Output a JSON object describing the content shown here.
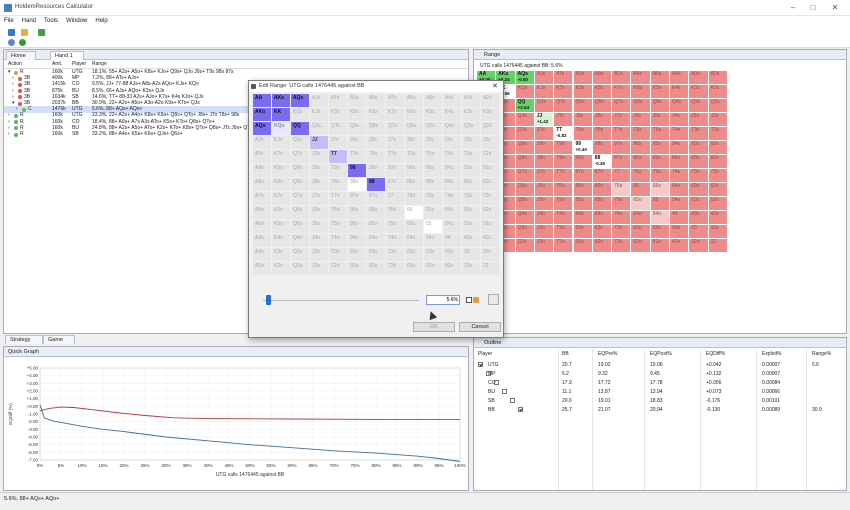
{
  "app": {
    "title": "HoldemResources Calculator"
  },
  "menu": [
    "File",
    "Hand",
    "Tools",
    "Window",
    "Help"
  ],
  "tabs_left": {
    "home": "Home",
    "hand": "Hand 1"
  },
  "tree": {
    "headers": [
      "Action",
      "Amt.",
      "Player",
      "Range"
    ],
    "rows": [
      {
        "action": "R",
        "amt": "160k",
        "player": "UTG",
        "range": "18.1%, 55+ A2s+ A5o+ K8s+ KJo+ Q9s+ QJo J9s+ T9s 98s 87s",
        "dot": "#d9a62a"
      },
      {
        "action": "3B",
        "amt": "400k",
        "player": "MP",
        "range": "7.2%, 88+ ATs+ AJo+",
        "dot": "#d9534f"
      },
      {
        "action": "3B",
        "amt": "1415k",
        "player": "CO",
        "range": "9.5%, JJ+ 77-88 AJs+ A8s-A2s AQo+ KJs+ KQo",
        "dot": "#d9534f"
      },
      {
        "action": "3B",
        "amt": "875k",
        "player": "BU",
        "range": "8.5%, 66+ AJs+ AQo+ K3s+ QJs",
        "dot": "#d9534f"
      },
      {
        "action": "3B",
        "amt": "1634k",
        "player": "SB",
        "range": "14.6%, TT+ 88-33 A2s+ AJo+ K7s+ K4s KJo+ QJs",
        "dot": "#d9534f"
      },
      {
        "action": "3B",
        "amt": "2037k",
        "player": "BB",
        "range": "30.9%, 22+ A2s+ A5o+ A3o-A2o K9s+ KTo+ QJs",
        "dot": "#d9534f"
      },
      {
        "action": "C",
        "amt": "1476k",
        "player": "UTG",
        "range": "5.6%, 88+ AQs+ AQo+",
        "dot": "#5cb85c"
      },
      {
        "action": "R",
        "amt": "160k",
        "player": "UTG",
        "range": "23.3%, 22+ A2s+ A4o+ K8s+ K9o+ Q8s+ QTo+ J8s+ JTo T8s+ 98s",
        "dot": "#5cb85c"
      },
      {
        "action": "R",
        "amt": "160k",
        "player": "CO",
        "range": "18.4%, 88+ A6s+ A7s A3s ATo+ K5s+ KTo+ Q8s+ QTo+",
        "dot": "#5cb85c"
      },
      {
        "action": "R",
        "amt": "160k",
        "player": "BU",
        "range": "24.8%, 88+ A2s+ A5o+ ATo+ K2s+ KTo+ K8s+ QTo+ Q8s+ JTs J9s+ QTo+ J8s+ JTo T8s+ 98s",
        "dot": "#5cb85c"
      },
      {
        "action": "R",
        "amt": "160k",
        "player": "SB",
        "range": "33.2%, 88+ A4s+ K5s+ K6s+ QJs+ Q6s+",
        "dot": "#5cb85c"
      }
    ]
  },
  "bottom_tabs": {
    "strategy": "Strategy Table",
    "game_tree": "Game Tree"
  },
  "quick_graph": {
    "title": "Quick Graph",
    "xlabel": "UTG calls 1476445 against BB",
    "ylabel": "EQDiff (%)",
    "yticks": [
      "+5.00",
      "+4.00",
      "+3.00",
      "+2.00",
      "+1.00",
      "+0.00",
      "-1.00",
      "-2.00",
      "-3.00",
      "-4.00",
      "-5.00",
      "-6.00",
      "-7.00"
    ],
    "xticks": [
      "0%",
      "5%",
      "10%",
      "15%",
      "20%",
      "25%",
      "30%",
      "35%",
      "40%",
      "45%",
      "50%",
      "55%",
      "60%",
      "65%",
      "70%",
      "75%",
      "80%",
      "85%",
      "90%",
      "95%",
      "100%"
    ]
  },
  "range_panel": {
    "title": "Range",
    "subtitle": "UTG calls 1476445 against BB: 5.6%"
  },
  "dialog": {
    "title": "Edit Range: UTG calls 1476445 against BB",
    "value": "5.6%",
    "ok": "OK",
    "cancel": "Cancel"
  },
  "hand_grid": [
    [
      "AA",
      "AKs",
      "AQs",
      "AJs",
      "ATs",
      "A9s",
      "A8s",
      "A7s",
      "A6s",
      "A5s",
      "A4s",
      "A3s",
      "A2s"
    ],
    [
      "AKo",
      "KK",
      "KQs",
      "KJs",
      "KTs",
      "K9s",
      "K8s",
      "K7s",
      "K6s",
      "K5s",
      "K4s",
      "K3s",
      "K2s"
    ],
    [
      "AQo",
      "KQo",
      "QQ",
      "QJs",
      "QTs",
      "Q9s",
      "Q8s",
      "Q7s",
      "Q6s",
      "Q5s",
      "Q4s",
      "Q3s",
      "Q2s"
    ],
    [
      "AJo",
      "KJo",
      "QJo",
      "JJ",
      "JTs",
      "J9s",
      "J8s",
      "J7s",
      "J6s",
      "J5s",
      "J4s",
      "J3s",
      "J2s"
    ],
    [
      "ATo",
      "KTo",
      "QTo",
      "JTo",
      "TT",
      "T9s",
      "T8s",
      "T7s",
      "T6s",
      "T5s",
      "T4s",
      "T3s",
      "T2s"
    ],
    [
      "A9o",
      "K9o",
      "Q9o",
      "J9o",
      "T9o",
      "99",
      "98s",
      "97s",
      "96s",
      "95s",
      "94s",
      "93s",
      "92s"
    ],
    [
      "A8o",
      "K8o",
      "Q8o",
      "J8o",
      "T8o",
      "98o",
      "88",
      "87s",
      "86s",
      "85s",
      "84s",
      "83s",
      "82s"
    ],
    [
      "A7o",
      "K7o",
      "Q7o",
      "J7o",
      "T7o",
      "97o",
      "87o",
      "77",
      "76s",
      "75s",
      "74s",
      "73s",
      "72s"
    ],
    [
      "A6o",
      "K6o",
      "Q6o",
      "J6o",
      "T6o",
      "96o",
      "86o",
      "76o",
      "66",
      "65s",
      "64s",
      "63s",
      "62s"
    ],
    [
      "A5o",
      "K5o",
      "Q5o",
      "J5o",
      "T5o",
      "95o",
      "85o",
      "75o",
      "65o",
      "55",
      "54s",
      "53s",
      "52s"
    ],
    [
      "A4o",
      "K4o",
      "Q4o",
      "J4o",
      "T4o",
      "94o",
      "84o",
      "74o",
      "64o",
      "54o",
      "44",
      "43s",
      "42s"
    ],
    [
      "A3o",
      "K3o",
      "Q3o",
      "J3o",
      "T3o",
      "93o",
      "83o",
      "73o",
      "63o",
      "53o",
      "43o",
      "33",
      "32s"
    ],
    [
      "A2o",
      "K2o",
      "Q2o",
      "J2o",
      "T2o",
      "92o",
      "82o",
      "72o",
      "62o",
      "52o",
      "42o",
      "32o",
      "22"
    ]
  ],
  "range_values": {
    "AA": "+0.00",
    "AKs": "+0.24",
    "QQ": "+2.54",
    "JJ": "+1.42",
    "TT": "-0.83",
    "99": "+0.40",
    "88": "-0.49",
    "AQs": "-0.00",
    "KK": "+2.56"
  },
  "outline": {
    "title": "Outline",
    "headers": [
      "Player",
      "BB",
      "EQPre%",
      "EQPost%",
      "EQDiff%",
      "Exploit%",
      "Range%"
    ],
    "rows": [
      {
        "checked": true,
        "player": "UTG",
        "bb": "20.7",
        "pre": "19.02",
        "post": "19.06",
        "diff": "+0.042",
        "exploit": "0.00007",
        "range": "5.6"
      },
      {
        "checked": false,
        "player": "MP",
        "bb": "5.2",
        "pre": "9.32",
        "post": "9.45",
        "diff": "+0.132",
        "exploit": "0.00007",
        "range": ""
      },
      {
        "checked": false,
        "player": "CO",
        "bb": "17.9",
        "pre": "17.72",
        "post": "17.78",
        "diff": "+0.056",
        "exploit": "0.00084",
        "range": ""
      },
      {
        "checked": false,
        "player": "BU",
        "bb": "11.1",
        "pre": "13.87",
        "post": "13.94",
        "diff": "+0.073",
        "exploit": "0.00066",
        "range": ""
      },
      {
        "checked": false,
        "player": "SB",
        "bb": "20.6",
        "pre": "19.01",
        "post": "18.83",
        "diff": "-0.176",
        "exploit": "0.00101",
        "range": ""
      },
      {
        "checked": true,
        "player": "BB",
        "bb": "25.7",
        "pre": "21.07",
        "post": "20.94",
        "diff": "-0.130",
        "exploit": "0.00089",
        "range": "30.9"
      }
    ]
  },
  "status": {
    "text": "5.6%, 88+ AQs+ AQo+"
  },
  "colors": {
    "selected_purple": "#7a6cf0",
    "light_purple": "#c4bef5",
    "range_red": "#ef8a8a",
    "range_green": "#68d068"
  }
}
